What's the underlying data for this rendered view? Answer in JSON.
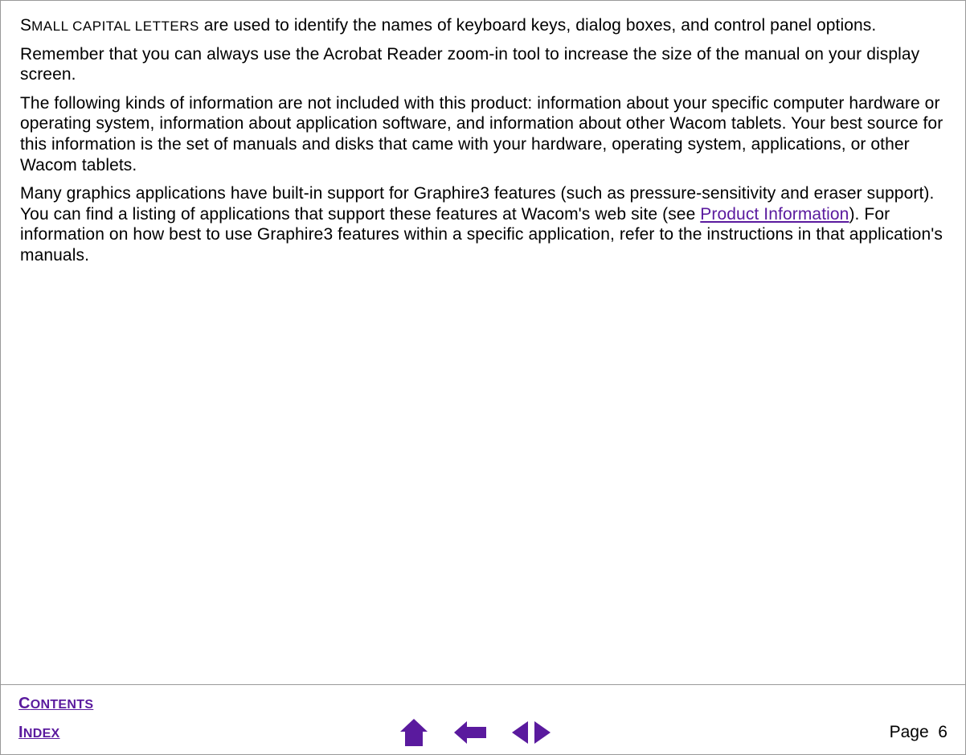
{
  "content": {
    "p1_lead_first": "S",
    "p1_lead_rest": "MALL CAPITAL LETTERS",
    "p1_tail": " are used to identify the names of keyboard keys, dialog boxes, and control panel options.",
    "p2": "Remember that you can always use the Acrobat Reader zoom-in tool to increase the size of the manual on your display screen.",
    "p3": "The following kinds of information are not included with this product: information about your specific computer hardware or operating system, information about application software, and information about other Wacom tablets. Your best source for this information is the set of manuals and disks that came with your hardware, operating system, applications, or other Wacom tablets.",
    "p4_a": "Many graphics applications have built-in support for Graphire3 features (such as pressure-sensitivity and eraser support).  You can find a listing of applications that support these features at Wacom's web site (see ",
    "p4_link": "Product Information",
    "p4_b": ").  For information on how best to use Graphire3 features within a specific application, refer to the instructions in that application's manuals."
  },
  "footer": {
    "contents_first": "C",
    "contents_rest": "ONTENTS",
    "index_first": "I",
    "index_rest": "NDEX",
    "page_label": "Page  6"
  },
  "colors": {
    "accent": "#5a1a9e"
  }
}
